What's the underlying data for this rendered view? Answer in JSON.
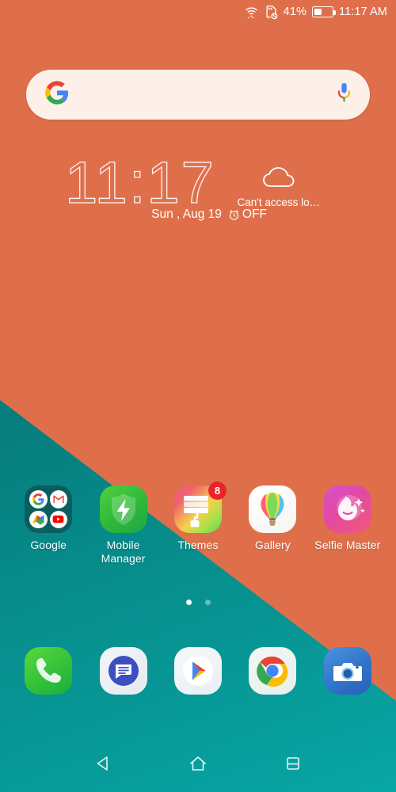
{
  "status_bar": {
    "wifi_icon": "wifi-icon",
    "sim_icon": "sim-card-no-service-icon",
    "battery_percent_label": "41%",
    "battery_level": 41,
    "battery_icon": "battery-icon",
    "time": "11:17 AM"
  },
  "search": {
    "google_icon": "google-logo-icon",
    "mic_icon": "microphone-icon",
    "placeholder": ""
  },
  "clock_widget": {
    "time": "11:17",
    "weather_icon": "cloud-icon",
    "weather_text": "Can't access lo…",
    "date": "Sun , Aug 19",
    "alarm_icon": "alarm-clock-icon",
    "alarm_state": "OFF"
  },
  "apps": [
    {
      "label": "Google",
      "icon": "google-folder-icon",
      "type": "folder",
      "folder_items": [
        "google-g-icon",
        "gmail-icon",
        "maps-icon",
        "youtube-icon"
      ]
    },
    {
      "label": "Mobile Manager",
      "icon": "shield-bolt-icon",
      "type": "app"
    },
    {
      "label": "Themes",
      "icon": "paint-roller-icon",
      "type": "app",
      "badge": "8"
    },
    {
      "label": "Gallery",
      "icon": "hot-air-balloon-icon",
      "type": "app"
    },
    {
      "label": "Selfie Master",
      "icon": "selfie-face-icon",
      "type": "app"
    }
  ],
  "page_dots": {
    "count": 2,
    "active_index": 0
  },
  "dock": [
    {
      "label": "Phone",
      "icon": "phone-icon"
    },
    {
      "label": "Messages",
      "icon": "messages-icon"
    },
    {
      "label": "Play Store",
      "icon": "play-store-icon"
    },
    {
      "label": "Chrome",
      "icon": "chrome-icon"
    },
    {
      "label": "Camera",
      "icon": "camera-icon"
    }
  ],
  "nav_bar": [
    {
      "label": "Back",
      "icon": "back-triangle-icon"
    },
    {
      "label": "Home",
      "icon": "home-icon"
    },
    {
      "label": "Recents",
      "icon": "recents-icon"
    }
  ],
  "colors": {
    "wallpaper_orange": "#df6f4b",
    "wallpaper_teal": "#0a7c7c",
    "search_bar_bg": "#fdf0e9",
    "badge_red": "#e8232a",
    "text_white": "#ffffff"
  }
}
